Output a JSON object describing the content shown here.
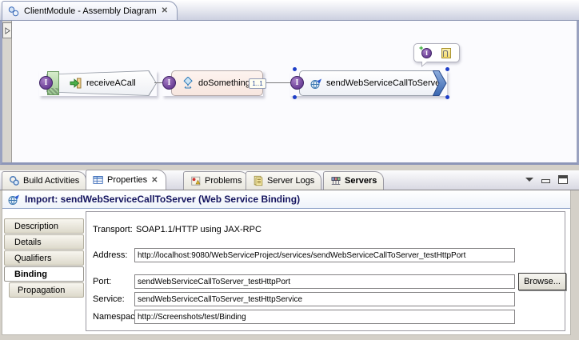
{
  "colors": {
    "selection_blue": "#1f3fc8",
    "interface_purple": "#7b52a0",
    "import_blue": "#4a6fb5",
    "export_green": "#9cc892",
    "title_navy": "#14145e"
  },
  "editor": {
    "tab_label": "ClientModule - Assembly Diagram",
    "close_glyph": "✕",
    "interface_glyph": "I",
    "components": {
      "export": {
        "label": "receiveACall"
      },
      "component": {
        "label": "doSomething",
        "multiplicity": "1..1"
      },
      "import": {
        "label": "sendWebServiceCallToServer"
      }
    }
  },
  "view_tabs": {
    "build_activities": "Build Activities",
    "properties": "Properties",
    "properties_close_glyph": "✕",
    "problems": "Problems",
    "server_logs": "Server Logs",
    "servers": "Servers"
  },
  "properties_view": {
    "title": "Import: sendWebServiceCallToServer (Web Service Binding)",
    "side_tabs": {
      "description": "Description",
      "details": "Details",
      "qualifiers": "Qualifiers",
      "binding": "Binding",
      "propagation": "Propagation"
    },
    "form": {
      "transport_label": "Transport:",
      "transport_value": "SOAP1.1/HTTP using JAX-RPC",
      "address_label": "Address:",
      "address_value": "http://localhost:9080/WebServiceProject/services/sendWebServiceCallToServer_testHttpPort",
      "port_label": "Port:",
      "port_value": "sendWebServiceCallToServer_testHttpPort",
      "service_label": "Service:",
      "service_value": "sendWebServiceCallToServer_testHttpService",
      "namespace_label": "Namespace:",
      "namespace_value": "http://Screenshots/test/Binding",
      "browse_label": "Browse..."
    }
  }
}
